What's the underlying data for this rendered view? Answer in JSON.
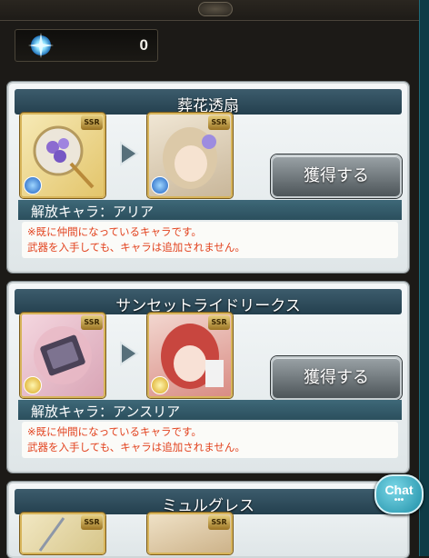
{
  "crystal": {
    "icon": "crystal-icon",
    "count": "0"
  },
  "cards": [
    {
      "title": "葬花透扇",
      "weapon_rarity": "SSR",
      "character_rarity": "SSR",
      "button_label": "獲得する",
      "unlock_label": "解放キャラ：アリア",
      "note_line1": "※既に仲間になっているキャラです。",
      "note_line2": "武器を入手しても、キャラは追加されません。"
    },
    {
      "title": "サンセットライドリークス",
      "weapon_rarity": "SSR",
      "character_rarity": "SSR",
      "button_label": "獲得する",
      "unlock_label": "解放キャラ：アンスリア",
      "note_line1": "※既に仲間になっているキャラです。",
      "note_line2": "武器を入手しても、キャラは追加されません。"
    },
    {
      "title": "ミュルグレス",
      "weapon_rarity": "SSR",
      "character_rarity": "SSR"
    }
  ],
  "chat": {
    "label": "Chat",
    "dots": "•••"
  },
  "colors": {
    "accent_teal": "#24404e",
    "note_red": "#e2421e",
    "gold_frame": "#d7b45a"
  }
}
